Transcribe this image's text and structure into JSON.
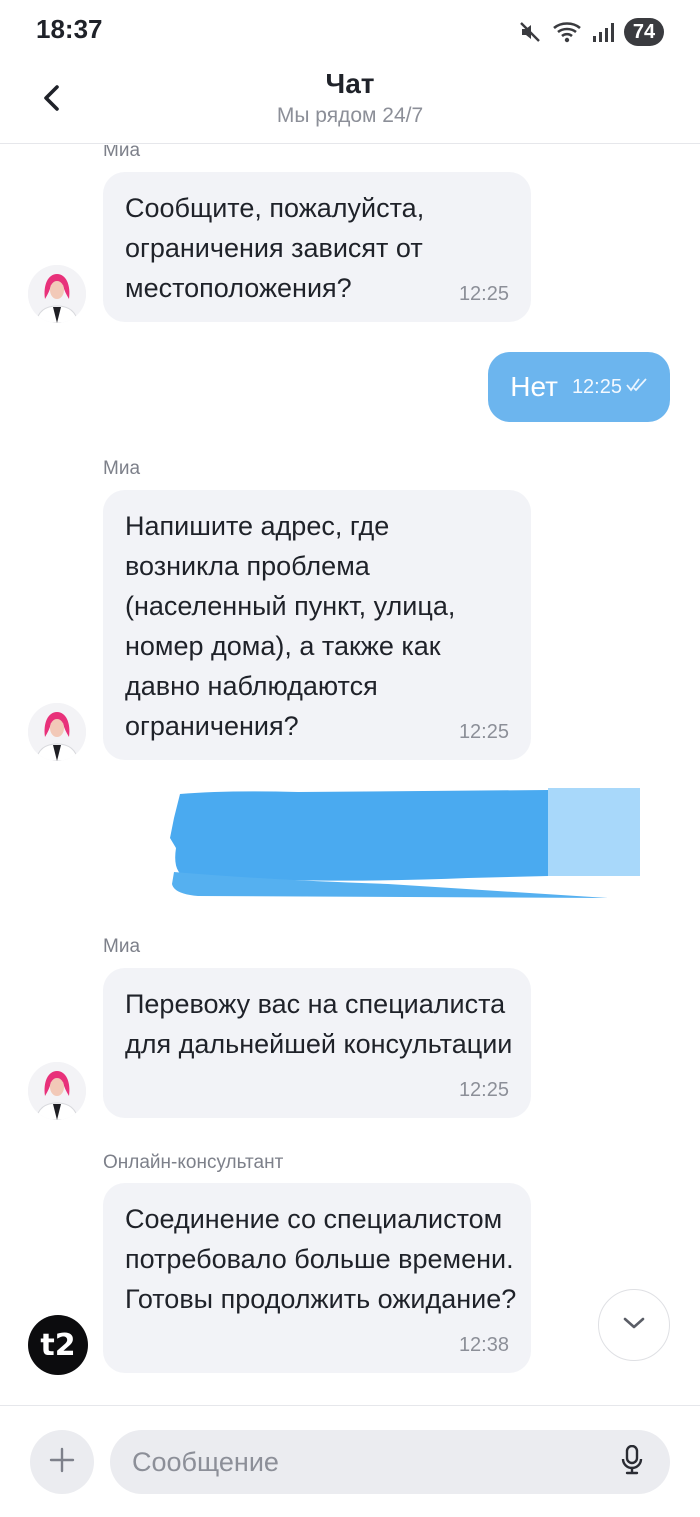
{
  "status_bar": {
    "time": "18:37",
    "battery": "74",
    "icons": [
      "mute-icon",
      "wifi-icon",
      "signal-icon",
      "battery-icon"
    ]
  },
  "header": {
    "title": "Чат",
    "subtitle": "Мы рядом 24/7",
    "back_icon": "chevron-left-icon"
  },
  "messages": [
    {
      "direction": "incoming",
      "sender": "Миа",
      "text": "Сообщите, пожалуйста, ограничения зависят от местоположения?",
      "time": "12:25",
      "avatar": "mia-avatar"
    },
    {
      "direction": "outgoing",
      "text": "Нет",
      "time": "12:25",
      "status_icon": "double-check-icon"
    },
    {
      "direction": "incoming",
      "sender": "Миа",
      "text": "Напишите адрес, где возникла проблема (населенный пункт, улица, номер дома), а также как давно наблюдаются ограничения?",
      "time": "12:25",
      "avatar": "mia-avatar"
    },
    {
      "direction": "outgoing",
      "redacted": true
    },
    {
      "direction": "incoming",
      "sender": "Миа",
      "text": "Перевожу вас на специалиста для дальнейшей консультации",
      "time": "12:25",
      "avatar": "mia-avatar"
    },
    {
      "direction": "incoming",
      "sender": "Онлайн-консультант",
      "text": "Соединение со специалистом потребовало больше времени. Готовы продолжить ожидание?",
      "time": "12:38",
      "avatar": "t2-logo-avatar"
    }
  ],
  "avatars": {
    "t2_logo_text": "t2"
  },
  "composer": {
    "placeholder": "Сообщение",
    "value": "",
    "attach_icon": "plus-icon",
    "mic_icon": "microphone-icon"
  },
  "colors": {
    "outgoing_bubble": "#6cb5ee",
    "incoming_bubble": "#f2f3f7",
    "redaction_blue": "#4aaaf0",
    "redaction_light": "#a8d8fa"
  }
}
